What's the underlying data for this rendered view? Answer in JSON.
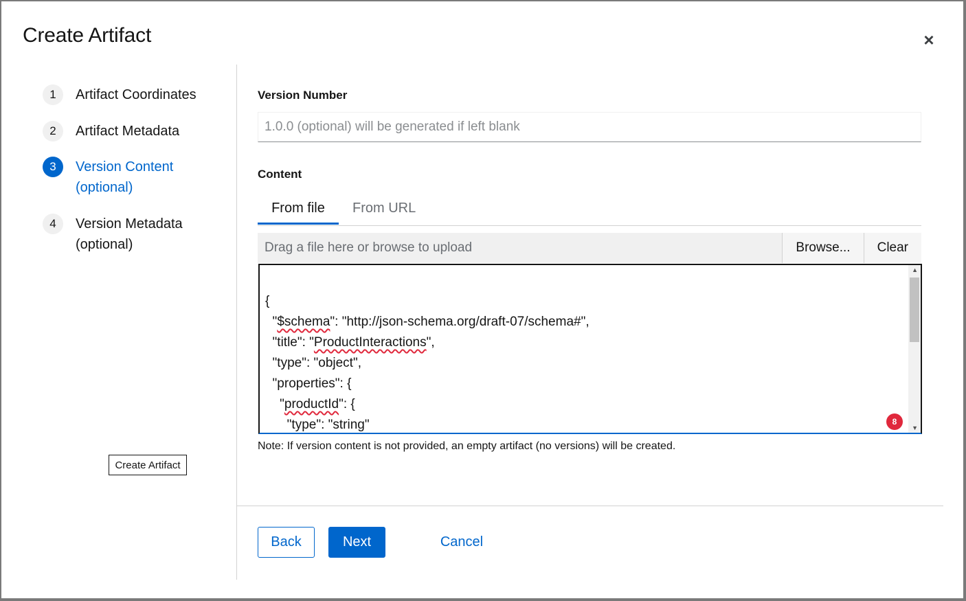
{
  "dialog": {
    "title": "Create Artifact",
    "close_label": "×"
  },
  "wizard_nav": {
    "steps": [
      {
        "number": "1",
        "label": "Artifact Coordinates",
        "current": false
      },
      {
        "number": "2",
        "label": "Artifact Metadata",
        "current": false
      },
      {
        "number": "3",
        "label": "Version Content (optional)",
        "current": true
      },
      {
        "number": "4",
        "label": "Version Metadata (optional)",
        "current": false
      }
    ],
    "tooltip": "Create Artifact"
  },
  "form": {
    "version_number": {
      "label": "Version Number",
      "value": "",
      "placeholder": "1.0.0 (optional) will be generated if left blank"
    },
    "content": {
      "label": "Content",
      "tabs": [
        {
          "label": "From file",
          "active": true
        },
        {
          "label": "From URL",
          "active": false
        }
      ],
      "upload": {
        "placeholder": "Drag a file here or browse to upload",
        "browse_label": "Browse...",
        "clear_label": "Clear"
      },
      "editor": {
        "lines": [
          "{",
          "  \"$schema\": \"http://json-schema.org/draft-07/schema#\",",
          "  \"title\": \"ProductInteractions\",",
          "  \"type\": \"object\",",
          "  \"properties\": {",
          "    \"productId\": {",
          "      \"type\": \"string\""
        ],
        "spelling_issue_count": "8"
      }
    },
    "note": "Note: If version content is not provided, an empty artifact (no versions) will be created."
  },
  "footer": {
    "back_label": "Back",
    "next_label": "Next",
    "cancel_label": "Cancel"
  },
  "colors": {
    "accent": "#0066cc",
    "error_badge": "#e0283c",
    "overlay": "#7a7a7a"
  }
}
